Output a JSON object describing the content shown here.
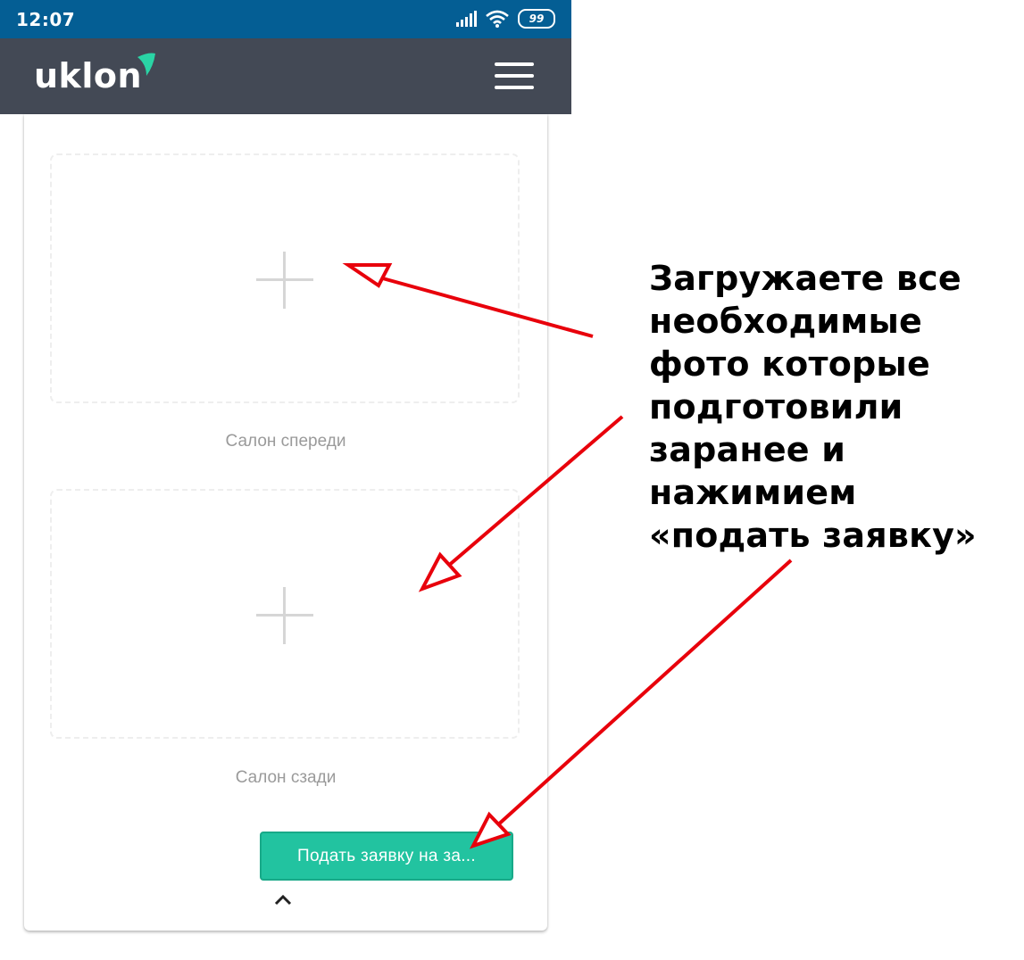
{
  "status_bar": {
    "time": "12:07",
    "battery": "99",
    "icons": [
      "signal-icon",
      "wifi-icon",
      "battery-icon"
    ]
  },
  "app_bar": {
    "logo_text": "uklon",
    "logo_color": "#2ad4a5",
    "menu_icon": "hamburger-menu-icon"
  },
  "uploads": [
    {
      "caption": "Салон спереди",
      "icon": "plus-icon"
    },
    {
      "caption": "Салон сзади",
      "icon": "plus-icon"
    }
  ],
  "submit_button": {
    "label": "Подать заявку на за..."
  },
  "collapse_icon": "chevron-up-icon",
  "annotation": {
    "lines": [
      "Загружаете все",
      "необходимые",
      "фото которые",
      "подготовили",
      "заранее и",
      "нажимием",
      "«подать заявку»"
    ],
    "arrow_color": "#e8000b"
  },
  "colors": {
    "status_bar": "#045e94",
    "app_bar": "#434955",
    "button": "#22c3a0"
  }
}
